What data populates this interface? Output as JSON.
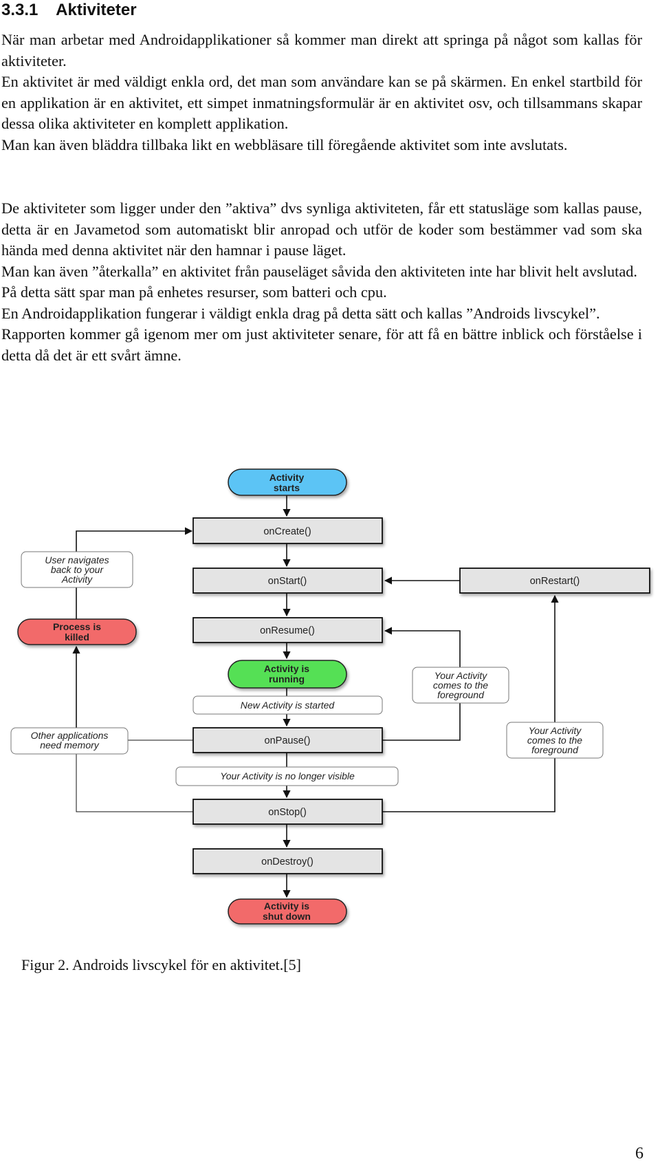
{
  "section": {
    "number": "3.3.1",
    "title": "Aktiviteter"
  },
  "paragraphs_block1": [
    "När man arbetar med Androidapplikationer så kommer man direkt att springa på något som kallas för aktiviteter.",
    "En aktivitet är med väldigt enkla ord, det man som användare kan se på skärmen. En enkel startbild för en applikation är en aktivitet, ett simpet inmatningsformulär är en aktivitet osv, och tillsammans skapar dessa olika aktiviteter en komplett applikation.",
    "Man kan även bläddra tillbaka likt en webbläsare till föregående aktivitet som inte avslutats."
  ],
  "paragraphs_block2": [
    "De aktiviteter som ligger under den ”aktiva” dvs synliga aktiviteten, får ett statusläge som kallas pause, detta är en Javametod som automatiskt blir anropad och  utför de koder som bestämmer vad som ska hända med denna aktivitet när den hamnar i pause läget.",
    "Man kan även ”återkalla” en aktivitet från pauseläget såvida den aktiviteten inte har blivit helt avslutad.",
    "På detta sätt spar man på enhetes resurser, som batteri och cpu.",
    "En Androidapplikation fungerar i väldigt enkla drag på detta sätt och kallas ”Androids livscykel”.",
    "Rapporten kommer gå igenom mer om just aktiviteter senare, för att få en bättre inblick och förståelse i detta då det är ett svårt ämne."
  ],
  "diagram": {
    "colors": {
      "start": "#5bc4f5",
      "running": "#55e055",
      "terminal_red": "#f26b6b",
      "callback_fill": "#e4e4e4",
      "note_fill": "#ffffff",
      "line": "#111111"
    },
    "terminals": {
      "activity_starts": [
        "Activity",
        "starts"
      ],
      "activity_running": [
        "Activity is",
        "running"
      ],
      "activity_shut_down": [
        "Activity is",
        "shut down"
      ],
      "process_killed": [
        "Process is",
        "killed"
      ]
    },
    "callbacks": {
      "on_create": "onCreate()",
      "on_start": "onStart()",
      "on_restart": "onRestart()",
      "on_resume": "onResume()",
      "on_pause": "onPause()",
      "on_stop": "onStop()",
      "on_destroy": "onDestroy()"
    },
    "notes": {
      "user_navigates_back": [
        "User navigates",
        "back to your",
        "Activity"
      ],
      "other_apps_need_memory": [
        "Other applications",
        "need memory"
      ],
      "new_activity_started": "New Activity is started",
      "no_longer_visible": "Your Activity is no longer visible",
      "foreground_1": [
        "Your Activity",
        "comes to the",
        "foreground"
      ],
      "foreground_2": [
        "Your Activity",
        "comes to the",
        "foreground"
      ]
    }
  },
  "figure_caption": "Figur 2. Androids livscykel för en aktivitet.[5]",
  "page_number": "6"
}
